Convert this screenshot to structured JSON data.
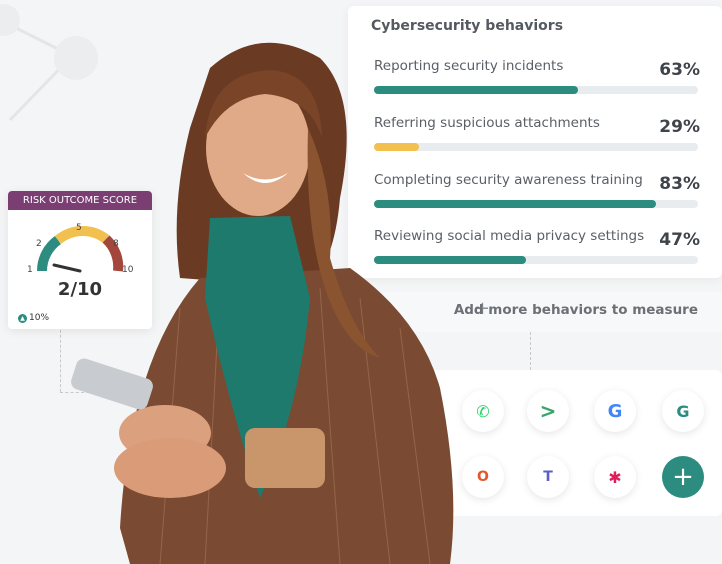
{
  "behaviors": {
    "title": "Cybersecurity behaviors",
    "items": [
      {
        "label": "Reporting security incidents",
        "percent_text": "63%",
        "value": 0.63,
        "color": "#2c8c80"
      },
      {
        "label": "Referring suspicious attachments",
        "percent_text": "29%",
        "value": 0.14,
        "color": "#f2c04e"
      },
      {
        "label": "Completing security awareness training",
        "percent_text": "83%",
        "value": 0.87,
        "color": "#2c8c80"
      },
      {
        "label": "Reviewing social media privacy settings",
        "percent_text": "47%",
        "value": 0.47,
        "color": "#2c8c80"
      }
    ],
    "add_more_label": "Add more behaviors to measure"
  },
  "risk": {
    "title": "RISK OUTCOME SCORE",
    "ticks": [
      "1",
      "2",
      "5",
      "8",
      "10"
    ],
    "score_text": "2/10",
    "change_text": "10%",
    "gauge_colors": [
      "#2c8c80",
      "#f2c04e",
      "#a3463b"
    ]
  },
  "apps": [
    {
      "name": "whatsapp-icon",
      "glyph": "✆",
      "color": "#25d366"
    },
    {
      "name": "prompt-icon",
      "glyph": ">",
      "color": "#3aa56a"
    },
    {
      "name": "google-icon",
      "glyph": "G",
      "color": "#4285f4"
    },
    {
      "name": "g-logo-icon",
      "glyph": "G",
      "color": "#2c8c80"
    },
    {
      "name": "office-icon",
      "glyph": "O",
      "color": "#e3582a"
    },
    {
      "name": "teams-icon",
      "glyph": "T",
      "color": "#5b5fc7"
    },
    {
      "name": "slack-icon",
      "glyph": "✱",
      "color": "#e01e5a"
    },
    {
      "name": "add-app-icon",
      "glyph": "+",
      "color": "#2c8c80"
    }
  ],
  "colors": {
    "accent": "#2c8c80",
    "brand_purple": "#7a3e72"
  }
}
